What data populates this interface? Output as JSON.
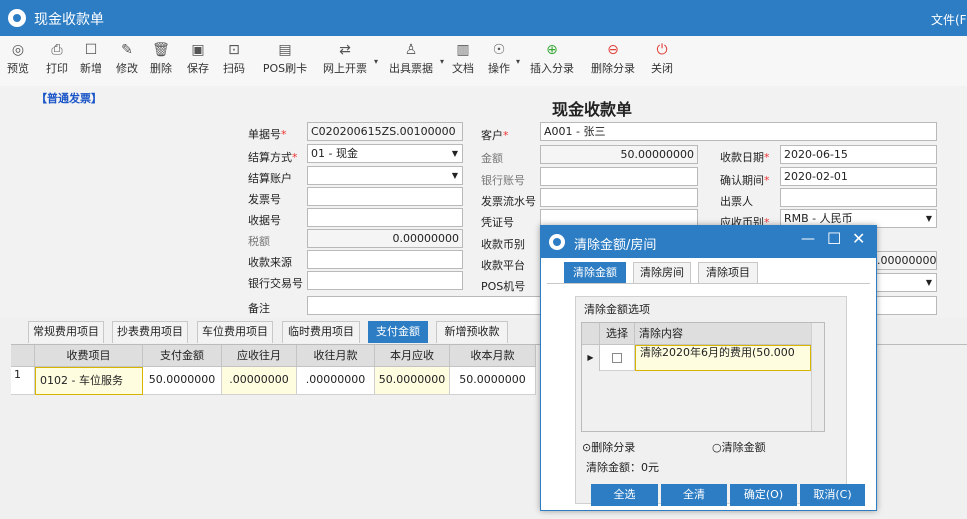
{
  "window": {
    "title": "现金收款单",
    "file_menu": "文件(F"
  },
  "toolbar": {
    "preview": "预览",
    "print": "打印",
    "new": "新增",
    "edit": "修改",
    "delete": "删除",
    "save": "保存",
    "scan": "扫码",
    "pos": "POS刷卡",
    "online_invoice": "网上开票",
    "issue_bill": "出具票据",
    "document": "文档",
    "operate": "操作",
    "insert_entry": "插入分录",
    "delete_entry": "删除分录",
    "close": "关闭"
  },
  "form": {
    "invoice_type": "【普通发票】",
    "title": "现金收款单",
    "bill_no_label": "单据号",
    "bill_no": "C020200615ZS.00100000",
    "customer_label": "客户",
    "customer": "A001  - 张三",
    "settle_label": "结算方式",
    "settle": "01 - 现金",
    "amount_label": "金额",
    "amount": "50.00000000",
    "date_label": "收款日期",
    "date": "2020-06-15",
    "settle_account_label": "结算账户",
    "settle_account": "",
    "bank_account_label": "银行账号",
    "bank_account": "",
    "confirm_period_label": "确认期间",
    "confirm_period": "2020-02-01",
    "invoice_no_label": "发票号",
    "invoice_no": "",
    "invoice_serial_label": "发票流水号",
    "invoice_serial": "",
    "drawer_label": "出票人",
    "drawer": "",
    "receipt_no_label": "收据号",
    "receipt_no": "",
    "voucher_label": "凭证号",
    "voucher": "",
    "ar_currency_label": "应收币别",
    "ar_currency": "RMB - 人民币",
    "tax_label": "税额",
    "tax": "0.00000000",
    "recv_currency_label": "收款币别",
    "source_label": "收款来源",
    "source": "",
    "platform_label": "收款平台",
    "bank_txn_label": "银行交易号",
    "bank_txn": "",
    "pos_label": "POS机号",
    "remark_label": "备注",
    "right_value": ".00000000"
  },
  "tabs": [
    "常规费用项目",
    "抄表费用项目",
    "车位费用项目",
    "临时费用项目",
    "支付金额",
    "新增预收款"
  ],
  "grid": {
    "headers": [
      "收费项目",
      "支付金额",
      "应收往月",
      "收往月款",
      "本月应收",
      "收本月款"
    ],
    "rows": [
      {
        "no": "1",
        "item": "0102 - 车位服务",
        "pay": "50.0000000",
        "due_prev": ".00000000",
        "recv_prev": ".00000000",
        "due_cur": "50.0000000",
        "recv_cur": "50.0000000"
      }
    ]
  },
  "dialog": {
    "title": "清除金额/房间",
    "tabs": [
      "清除金额",
      "清除房间",
      "清除项目"
    ],
    "section": "清除金额选项",
    "col_select": "选择",
    "col_content": "清除内容",
    "row_content": "清除2020年6月的费用(50.000",
    "option_delete": "删除分录",
    "option_clear": "清除金额",
    "clear_amount": "清除金额：0元",
    "btn_select_all": "全选",
    "btn_clear_all": "全清",
    "btn_ok": "确定(O)",
    "btn_cancel": "取消(C)"
  }
}
